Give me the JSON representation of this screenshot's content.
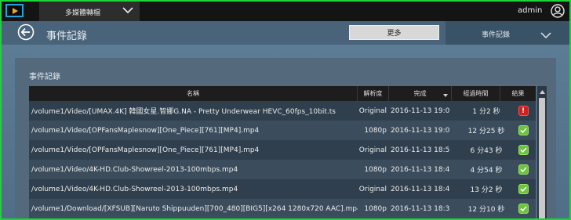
{
  "topbar": {
    "app_menu_label": "多媒體轉檔",
    "username": "admin"
  },
  "header": {
    "title": "事件記錄",
    "more_label": "更多",
    "view_select_label": "事件記錄"
  },
  "panel": {
    "title": "事件記錄"
  },
  "table": {
    "columns": {
      "name": "名稱",
      "resolution": "解析度",
      "done": "完成",
      "elapsed": "經過時間",
      "result": "結果"
    },
    "rows": [
      {
        "name": "/volume1/Video/[UMAX.4K] 韓國女星.智娜G.NA - Pretty Underwear HEVC_60fps_10bit.ts",
        "resolution": "Original",
        "done": "2016-11-13 19:0...",
        "elapsed": "1 分2 秒",
        "result": "error"
      },
      {
        "name": "/volume1/Video/[OPFansMaplesnow][One_Piece][761][MP4].mp4",
        "resolution": "1080p",
        "done": "2016-11-13 19:0...",
        "elapsed": "12 分25 秒",
        "result": "success"
      },
      {
        "name": "/volume1/Video/[OPFansMaplesnow][One_Piece][761][MP4].mp4",
        "resolution": "Original",
        "done": "2016-11-13 18:5...",
        "elapsed": "6 分43 秒",
        "result": "success"
      },
      {
        "name": "/volume1/Video/4K-HD.Club-Showreel-2013-100mbps.mp4",
        "resolution": "1080p",
        "done": "2016-11-13 18:4...",
        "elapsed": "4 分54 秒",
        "result": "success"
      },
      {
        "name": "/volume1/Video/4K-HD.Club-Showreel-2013-100mbps.mp4",
        "resolution": "Original",
        "done": "2016-11-13 18:4...",
        "elapsed": "13 分2 秒",
        "result": "success"
      },
      {
        "name": "/volume1/Download/[XFSUB][Naruto Shippuuden][700_480][BIG5][x264 1280x720 AAC].mp4",
        "resolution": "1080p",
        "done": "2016-11-13 18:3...",
        "elapsed": "12 分10 秒",
        "result": "success"
      }
    ]
  },
  "colors": {
    "accent_green": "#1fd23a",
    "success": "#6bc43a",
    "error": "#d01f1f"
  }
}
